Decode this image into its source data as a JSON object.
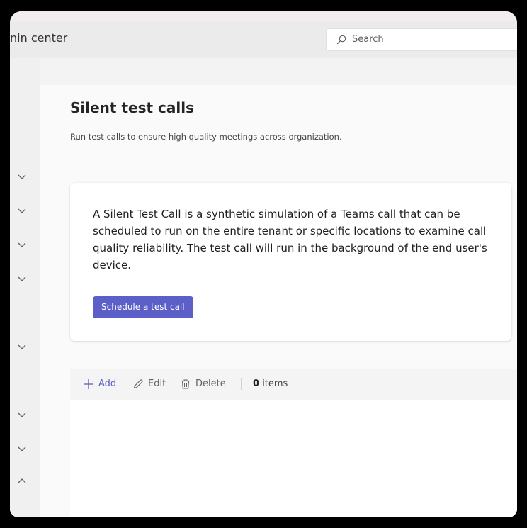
{
  "header": {
    "app_title": "nin center",
    "search_placeholder": "Search"
  },
  "page": {
    "title": "Silent test calls",
    "subtitle": "Run test calls to ensure high quality meetings across organization."
  },
  "card": {
    "description": "A Silent Test Call is a synthetic simulation of a Teams call that can be scheduled to run on the entire tenant or specific locations to examine call quality reliability. The test call will run in the background of the end user's device.",
    "button_label": "Schedule a test call"
  },
  "toolbar": {
    "add_label": "Add",
    "edit_label": "Edit",
    "delete_label": "Delete",
    "item_count": "0",
    "items_label": "items"
  },
  "icons": {
    "search": "search-icon",
    "add": "plus-icon",
    "edit": "pencil-icon",
    "delete": "trash-icon",
    "nav_expand": "chevron-down-icon",
    "nav_collapse": "chevron-up-icon"
  },
  "colors": {
    "accent": "#5b5fc7"
  }
}
